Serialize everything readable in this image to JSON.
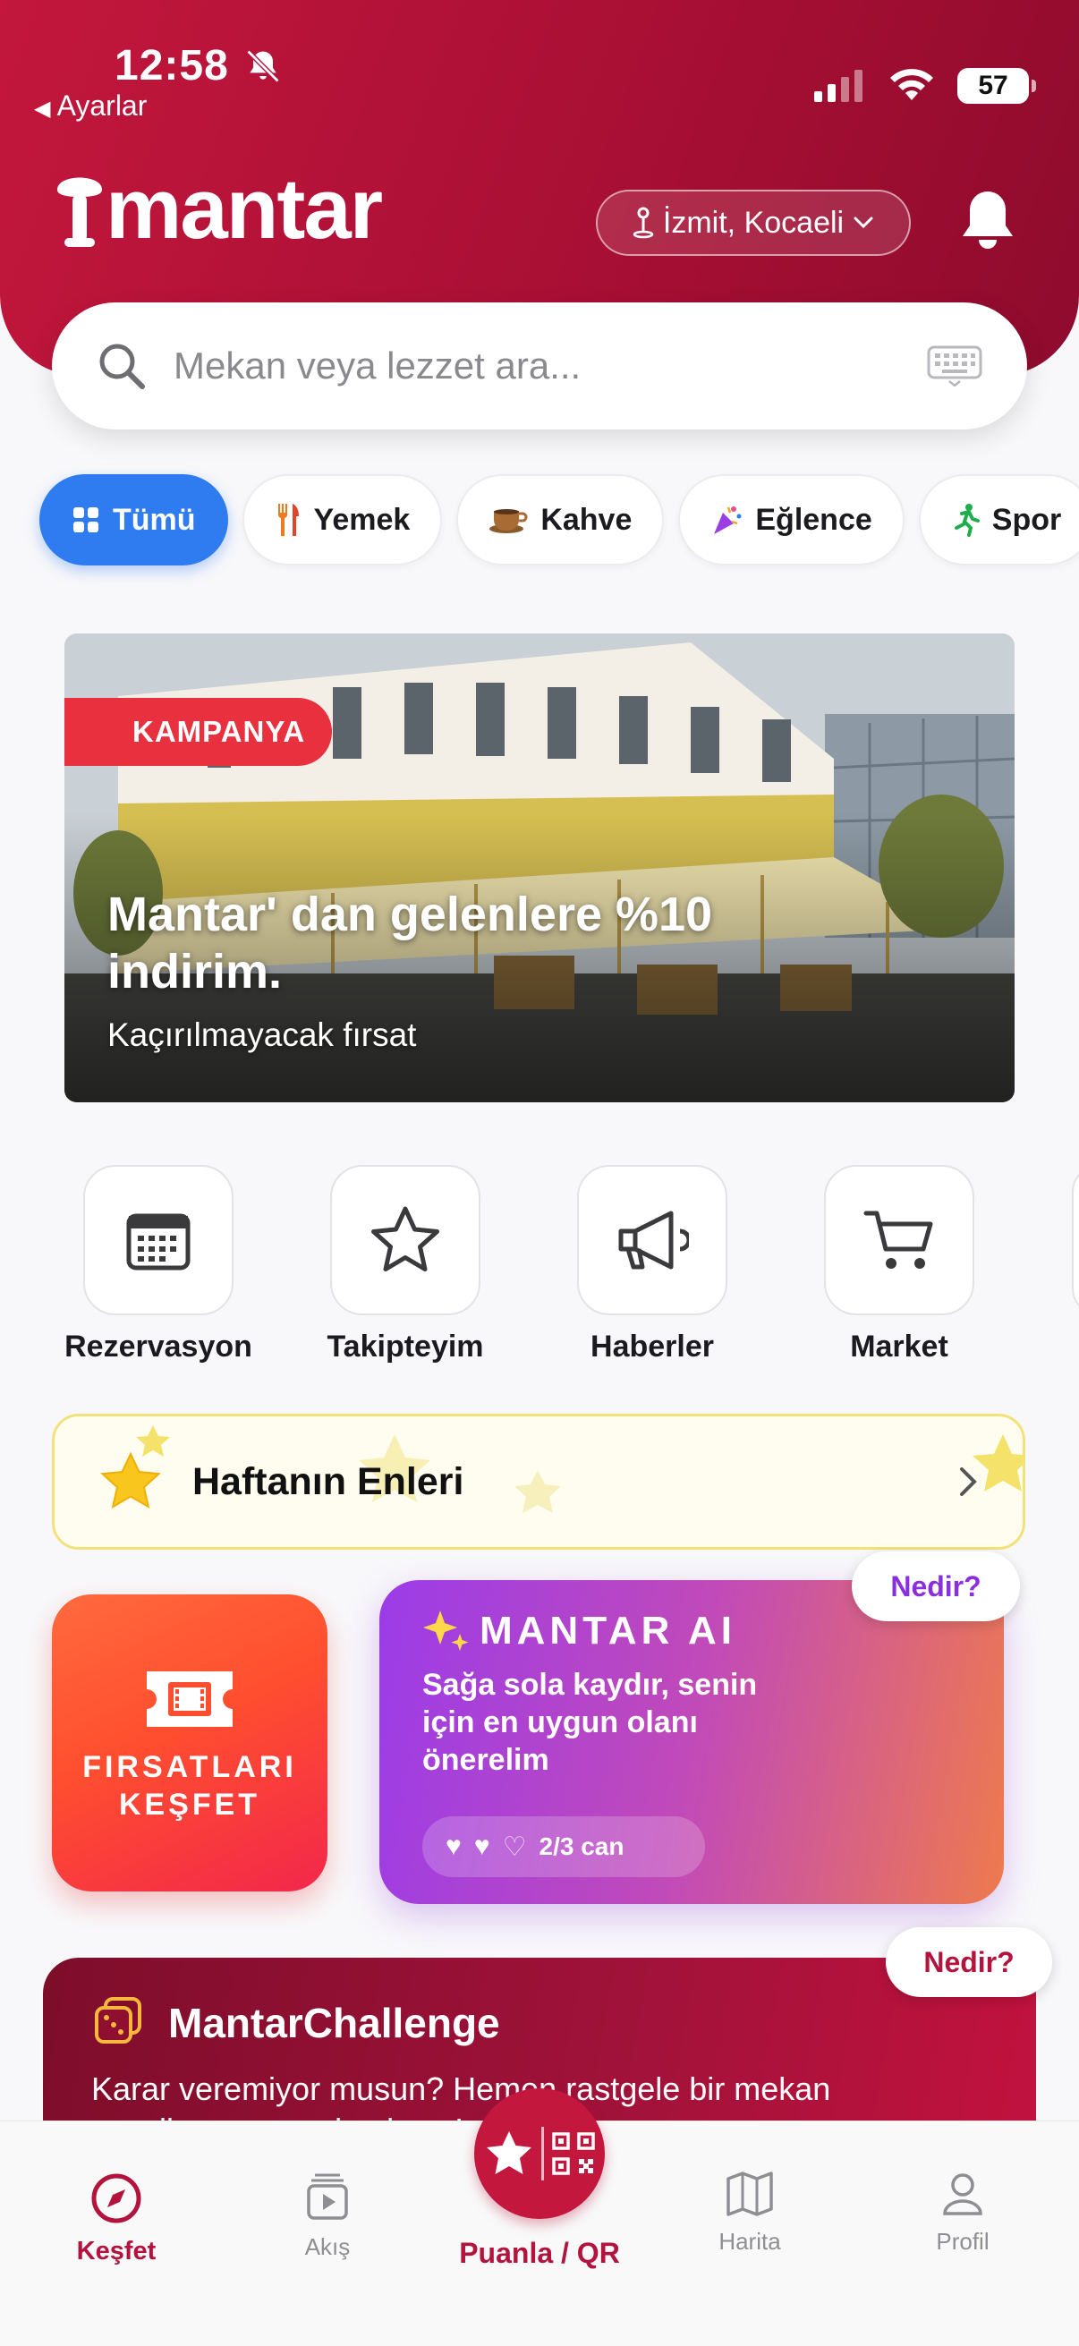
{
  "status_bar": {
    "time": "12:58",
    "back_label": "Ayarlar",
    "battery": "57"
  },
  "header": {
    "logo": "mantar",
    "location": "İzmit, Kocaeli"
  },
  "search": {
    "placeholder": "Mekan veya lezzet ara..."
  },
  "categories": [
    {
      "label": "Tümü",
      "icon": "grid-icon",
      "active": true
    },
    {
      "label": "Yemek",
      "icon": "fork-knife-icon"
    },
    {
      "label": "Kahve",
      "icon": "coffee-cup-icon"
    },
    {
      "label": "Eğlence",
      "icon": "party-icon"
    },
    {
      "label": "Spor",
      "icon": "running-icon"
    }
  ],
  "banner": {
    "tag": "KAMPANYA",
    "title": "Mantar' dan gelenlere %10 indirim.",
    "subtitle": "Kaçırılmayacak fırsat"
  },
  "quick_actions": [
    {
      "label": "Rezervasyon",
      "icon": "calendar-icon"
    },
    {
      "label": "Takipteyim",
      "icon": "star-icon"
    },
    {
      "label": "Haberler",
      "icon": "megaphone-icon"
    },
    {
      "label": "Market",
      "icon": "cart-icon"
    }
  ],
  "week_best": {
    "label": "Haftanın Enleri"
  },
  "deals_card": {
    "line1": "FIRSATLARI",
    "line2": "KEŞFET"
  },
  "ai_card": {
    "title": "MANTAR AI",
    "description": "Sağa sola kaydır, senin için en uygun olanı önerelim",
    "lives": "2/3 can",
    "help": "Nedir?"
  },
  "challenge": {
    "title": "MantarChallenge",
    "description": "Karar veremiyor musun? Hemen rastgele bir mekan seçelim, macera başlasın!",
    "help": "Nedir?"
  },
  "tabbar": {
    "explore": "Keşfet",
    "feed": "Akış",
    "center": "Puanla / QR",
    "map": "Harita",
    "profile": "Profil"
  },
  "colors": {
    "brand": "#b3133d",
    "active_chip": "#2f7bf0",
    "ai_gradient_start": "#9b3ce8",
    "ai_gradient_end": "#ee7a4e"
  }
}
